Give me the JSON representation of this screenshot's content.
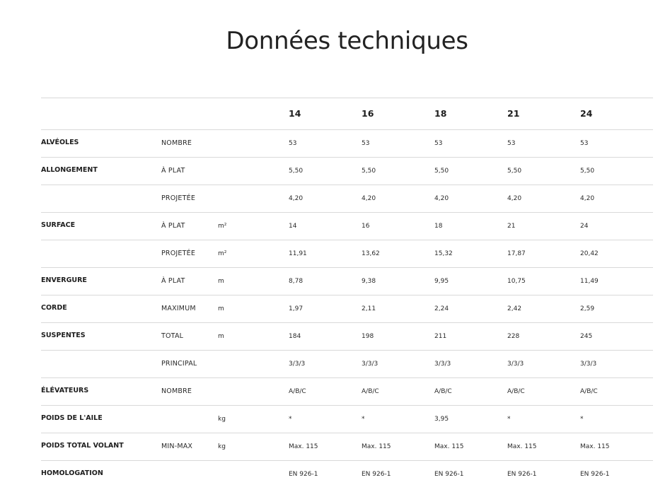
{
  "page": {
    "title": "Données techniques"
  },
  "sizes": [
    "14",
    "16",
    "18",
    "21",
    "24"
  ],
  "rows": [
    {
      "label": "ALVÉOLES",
      "sub": "NOMBRE",
      "unit": "",
      "values": [
        "53",
        "53",
        "53",
        "53",
        "53"
      ]
    },
    {
      "label": "ALLONGEMENT",
      "sub": "À PLAT",
      "unit": "",
      "values": [
        "5,50",
        "5,50",
        "5,50",
        "5,50",
        "5,50"
      ]
    },
    {
      "label": "",
      "sub": "PROJETÉE",
      "unit": "",
      "values": [
        "4,20",
        "4,20",
        "4,20",
        "4,20",
        "4,20"
      ]
    },
    {
      "label": "SURFACE",
      "sub": "À PLAT",
      "unit": "m²",
      "values": [
        "14",
        "16",
        "18",
        "21",
        "24"
      ]
    },
    {
      "label": "",
      "sub": "PROJETÉE",
      "unit": "m²",
      "values": [
        "11,91",
        "13,62",
        "15,32",
        "17,87",
        "20,42"
      ]
    },
    {
      "label": "ENVERGURE",
      "sub": "À PLAT",
      "unit": "m",
      "values": [
        "8,78",
        "9,38",
        "9,95",
        "10,75",
        "11,49"
      ]
    },
    {
      "label": "CORDE",
      "sub": "MAXIMUM",
      "unit": "m",
      "values": [
        "1,97",
        "2,11",
        "2,24",
        "2,42",
        "2,59"
      ]
    },
    {
      "label": "SUSPENTES",
      "sub": "TOTAL",
      "unit": "m",
      "values": [
        "184",
        "198",
        "211",
        "228",
        "245"
      ]
    },
    {
      "label": "",
      "sub": "PRINCIPAL",
      "unit": "",
      "values": [
        "3/3/3",
        "3/3/3",
        "3/3/3",
        "3/3/3",
        "3/3/3"
      ]
    },
    {
      "label": "ÉLÉVATEURS",
      "sub": "NOMBRE",
      "unit": "",
      "values": [
        "A/B/C",
        "A/B/C",
        "A/B/C",
        "A/B/C",
        "A/B/C"
      ]
    },
    {
      "label": "POIDS DE L'AILE",
      "sub": "",
      "unit": "kg",
      "values": [
        "*",
        "*",
        "3,95",
        "*",
        "*"
      ]
    },
    {
      "label": "POIDS TOTAL VOLANT",
      "sub": "MIN-MAX",
      "unit": "kg",
      "values": [
        "Max. 115",
        "Max. 115",
        "Max. 115",
        "Max. 115",
        "Max. 115"
      ]
    },
    {
      "label": "HOMOLOGATION",
      "sub": "",
      "unit": "",
      "values": [
        "EN 926-1",
        "EN 926-1",
        "EN 926-1",
        "EN 926-1",
        "EN 926-1"
      ]
    }
  ]
}
